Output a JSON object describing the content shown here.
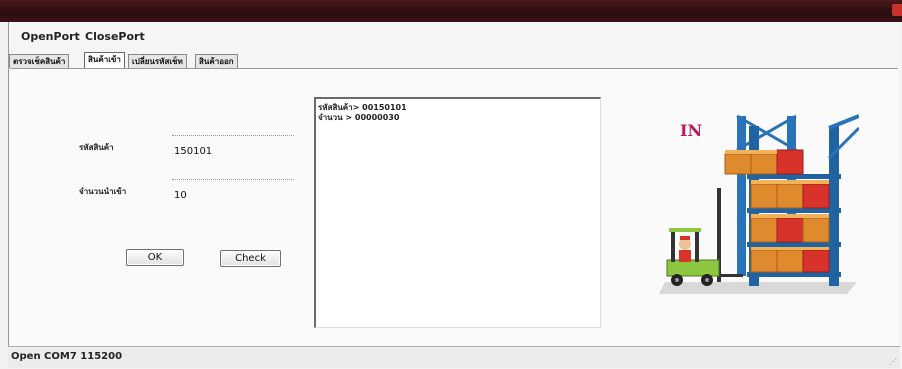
{
  "menu": {
    "items": [
      {
        "label": "OpenPort"
      },
      {
        "label": "ClosePort"
      }
    ]
  },
  "tabs": [
    {
      "label": "ตรวจเช็คสินค้า",
      "active": false
    },
    {
      "label": "สินค้าเข้า",
      "active": true
    },
    {
      "label": "เปลี่ยนรหัสเช็ท",
      "active": false
    },
    {
      "label": "สินค้าออก",
      "active": false
    }
  ],
  "form": {
    "product_code_label": "รหัสสินค้า",
    "product_code_value": "150101",
    "quantity_label": "จำนวนนำเข้า",
    "quantity_value": "10",
    "ok_label": "OK",
    "check_label": "Check"
  },
  "log": {
    "lines": [
      "รหัสสินค้า> 00150101",
      "จำนวน > 00000030"
    ]
  },
  "illustration": {
    "in_label": "IN",
    "colors": {
      "rack": "#2a73b8",
      "box": "#e08a2e",
      "box_top": "#f2b25a",
      "box_red": "#d8332a",
      "forklift": "#8dc63f",
      "in_text": "#c2185b"
    }
  },
  "status": {
    "text": "Open COM7  115200"
  }
}
